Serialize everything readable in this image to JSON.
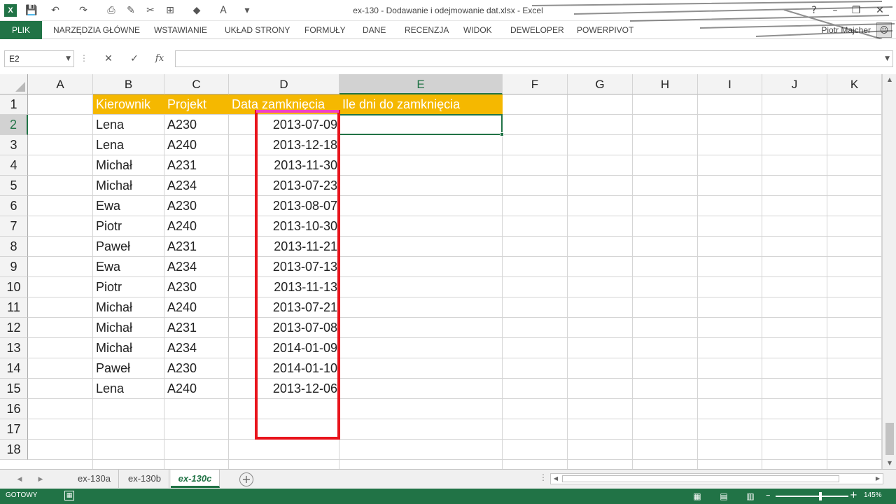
{
  "window": {
    "title": "ex-130 - Dodawanie i odejmowanie dat.xlsx - Excel",
    "app_logo": "X",
    "minimize": "–",
    "restore": "❐",
    "close": "✕",
    "help": "?"
  },
  "quick_access": [
    {
      "name": "save-icon",
      "glyph": "💾"
    },
    {
      "name": "undo-icon",
      "glyph": "↶"
    },
    {
      "name": "redo-icon",
      "glyph": "↷"
    },
    {
      "name": "print-preview-icon",
      "glyph": "⎙"
    },
    {
      "name": "spelling-icon",
      "glyph": "✎"
    },
    {
      "name": "format-painter-icon",
      "glyph": "✂"
    },
    {
      "name": "border-icon",
      "glyph": "⊞"
    },
    {
      "name": "fill-color-icon",
      "glyph": "◆"
    },
    {
      "name": "font-color-icon",
      "glyph": "A"
    },
    {
      "name": "customize-toolbar-icon",
      "glyph": "▾"
    }
  ],
  "ribbon": {
    "file_tab": "PLIK",
    "tabs": [
      "NARZĘDZIA GŁÓWNE",
      "WSTAWIANIE",
      "UKŁAD STRONY",
      "FORMUŁY",
      "DANE",
      "RECENZJA",
      "WIDOK",
      "DEWELOPER",
      "POWERPIVOT"
    ],
    "user_name": "Piotr Majcher",
    "avatar_glyph": "☺"
  },
  "formula_bar": {
    "name_box": "E2",
    "cancel": "✕",
    "enter": "✓",
    "fx": "fx",
    "formula": "",
    "separator": "⋮"
  },
  "columns": [
    "A",
    "B",
    "C",
    "D",
    "E",
    "F",
    "G",
    "H",
    "I",
    "J",
    "K"
  ],
  "selected_column": "E",
  "selected_row": "2",
  "rows": [
    "1",
    "2",
    "3",
    "4",
    "5",
    "6",
    "7",
    "8",
    "9",
    "10",
    "11",
    "12",
    "13",
    "14",
    "15",
    "16",
    "17",
    "18"
  ],
  "table": {
    "headers": [
      "Kierownik",
      "Projekt",
      "Data zamknięcia",
      "Ile dni do zamknięcia"
    ],
    "header_color": "#f5b800",
    "data": [
      [
        "Lena",
        "A230",
        "2013-07-09"
      ],
      [
        "Lena",
        "A240",
        "2013-12-18"
      ],
      [
        "Michał",
        "A231",
        "2013-11-30"
      ],
      [
        "Michał",
        "A234",
        "2013-07-23"
      ],
      [
        "Ewa",
        "A230",
        "2013-08-07"
      ],
      [
        "Piotr",
        "A240",
        "2013-10-30"
      ],
      [
        "Paweł",
        "A231",
        "2013-11-21"
      ],
      [
        "Ewa",
        "A234",
        "2013-07-13"
      ],
      [
        "Piotr",
        "A230",
        "2013-11-13"
      ],
      [
        "Michał",
        "A240",
        "2013-07-21"
      ],
      [
        "Michał",
        "A231",
        "2013-07-08"
      ],
      [
        "Michał",
        "A234",
        "2014-01-09"
      ],
      [
        "Paweł",
        "A230",
        "2014-01-10"
      ],
      [
        "Lena",
        "A240",
        "2013-12-06"
      ]
    ]
  },
  "annotation_color": "#e8141c",
  "sheet_tabs": [
    "ex-130a",
    "ex-130b",
    "ex-130c"
  ],
  "active_sheet": "ex-130c",
  "sheet_nav": {
    "prev": "◀",
    "next": "▶",
    "add": "+",
    "more": "⋮"
  },
  "status_bar": {
    "status": "GOTOWY",
    "macro_glyph": "▦",
    "views": [
      "▦",
      "▤",
      "▥"
    ],
    "zoom_minus": "–",
    "zoom_plus": "+",
    "zoom_level": "145%",
    "zoom_fraction": 0.62
  },
  "accent_color": "#217346"
}
